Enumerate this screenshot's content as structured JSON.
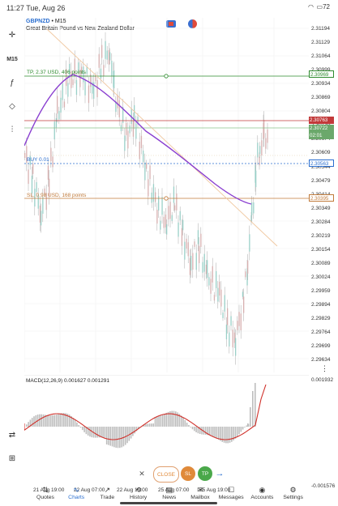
{
  "status": {
    "time": "11:27",
    "date": "Tue, Aug 26",
    "battery": "72"
  },
  "symbol": {
    "code": "GBPNZD",
    "sep": " • ",
    "tf": "M15",
    "name": "Great Britain Pound vs New Zealand Dollar"
  },
  "toolbar": {
    "timeframe": "M15"
  },
  "lines": {
    "tp_label": "TP, 2.37 USD, 406 points",
    "buy_label": "BUY 0.01",
    "sl_label": "SL, 0.98 USD, 168 points"
  },
  "price_axis": [
    "2.31194",
    "2.31129",
    "2.31064",
    "2.30999",
    "2.30934",
    "2.30869",
    "2.30804",
    "2.30739",
    "2.30674",
    "2.30609",
    "2.30544",
    "2.30479",
    "2.30414",
    "2.30349",
    "2.30284",
    "2.30219",
    "2.30154",
    "2.30089",
    "2.30024",
    "2.29959",
    "2.29894",
    "2.29829",
    "2.29764",
    "2.29699",
    "2.29634"
  ],
  "price_tags": {
    "tp": "2.30969",
    "red": "2.30763",
    "bid": "2.30722",
    "countdown": "02:01",
    "buy": "2.30563",
    "sl": "2.30395"
  },
  "macd": {
    "title": "MACD(12,26,9) 0.001627 0.001291",
    "max": "0.001932",
    "min": "-0.001576"
  },
  "time_axis": [
    "21 Aug 19:00",
    "22 Aug 07:00",
    "22 Aug 19:00",
    "25 Aug 07:00",
    "25 Aug 19:00"
  ],
  "trade_buttons": {
    "close": "CLOSE",
    "sl": "SL",
    "tp": "TP"
  },
  "nav": [
    {
      "label": "Quotes",
      "icon": "⇅"
    },
    {
      "label": "Charts",
      "icon": "∿"
    },
    {
      "label": "Trade",
      "icon": "↗"
    },
    {
      "label": "History",
      "icon": "⟲"
    },
    {
      "label": "News",
      "icon": "▤"
    },
    {
      "label": "Mailbox",
      "icon": "✉"
    },
    {
      "label": "Messages",
      "icon": "☐"
    },
    {
      "label": "Accounts",
      "icon": "◉"
    },
    {
      "label": "Settings",
      "icon": "⚙"
    }
  ],
  "colors": {
    "tp": "#2e8b2e",
    "sl": "#c07a3a",
    "buy": "#2a6ecf",
    "red": "#c23a3a",
    "bid": "#6ba86b",
    "ma": "#8a3fd0",
    "macd_signal": "#d0302a"
  }
}
